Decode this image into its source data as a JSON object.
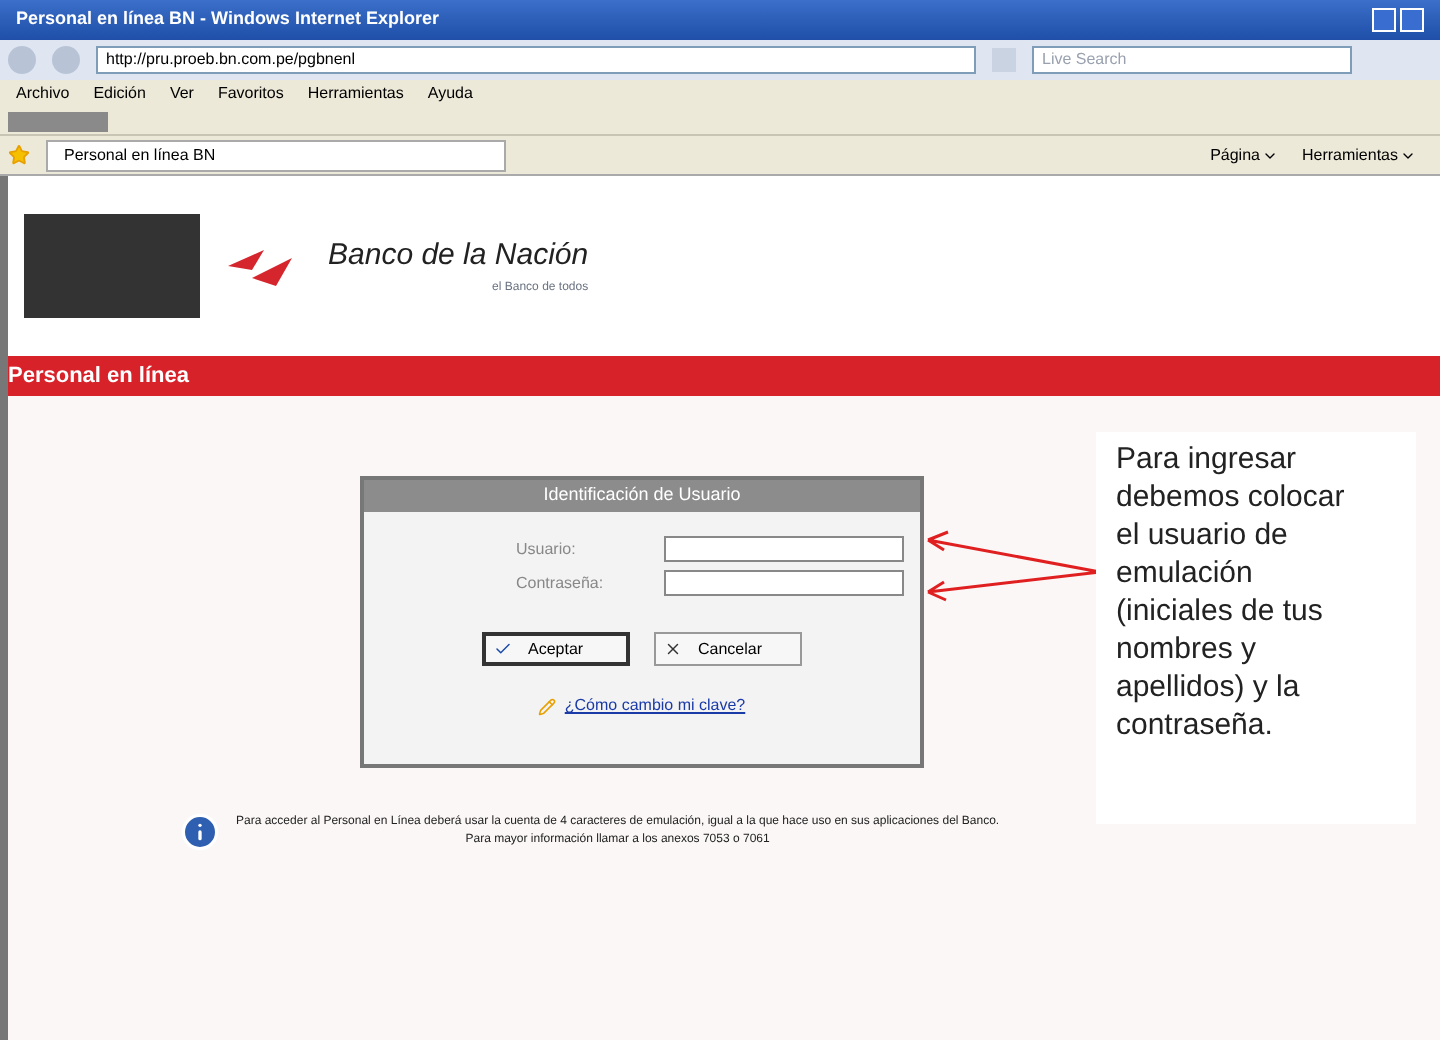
{
  "window": {
    "title": "Personal en línea BN - Windows Internet Explorer"
  },
  "address_bar": {
    "url": "http://pru.proeb.bn.com.pe/pgbnenl",
    "search_placeholder": "Live Search"
  },
  "menu_bar": [
    "Archivo",
    "Edición",
    "Ver",
    "Favoritos",
    "Herramientas",
    "Ayuda"
  ],
  "tab": {
    "label": "Personal en línea BN"
  },
  "command_bar": [
    "Página",
    "Herramientas"
  ],
  "header": {
    "brand": "Banco de la Nación",
    "slogan": "el Banco de todos"
  },
  "section_bar": {
    "title": "Personal en línea"
  },
  "login": {
    "title": "Identificación de Usuario",
    "fields": [
      {
        "label": "Usuario:"
      },
      {
        "label": "Contraseña:"
      }
    ],
    "buttons": [
      {
        "kind": "accept",
        "label": "Aceptar"
      },
      {
        "kind": "cancel",
        "label": "Cancelar"
      }
    ],
    "link": "¿Cómo cambio mi clave?"
  },
  "info": {
    "line_1": "Para acceder al Personal en Línea deberá usar la cuenta de 4 caracteres de emulación, igual a la que hace uso en sus aplicaciones del Banco.",
    "line_2": "Para mayor información llamar a los anexos 7053 o 7061"
  },
  "annotation": {
    "text": "Para ingresar debemos colocar el usuario de emulación (iniciales de tus nombres y apellidos) y la contraseña."
  }
}
